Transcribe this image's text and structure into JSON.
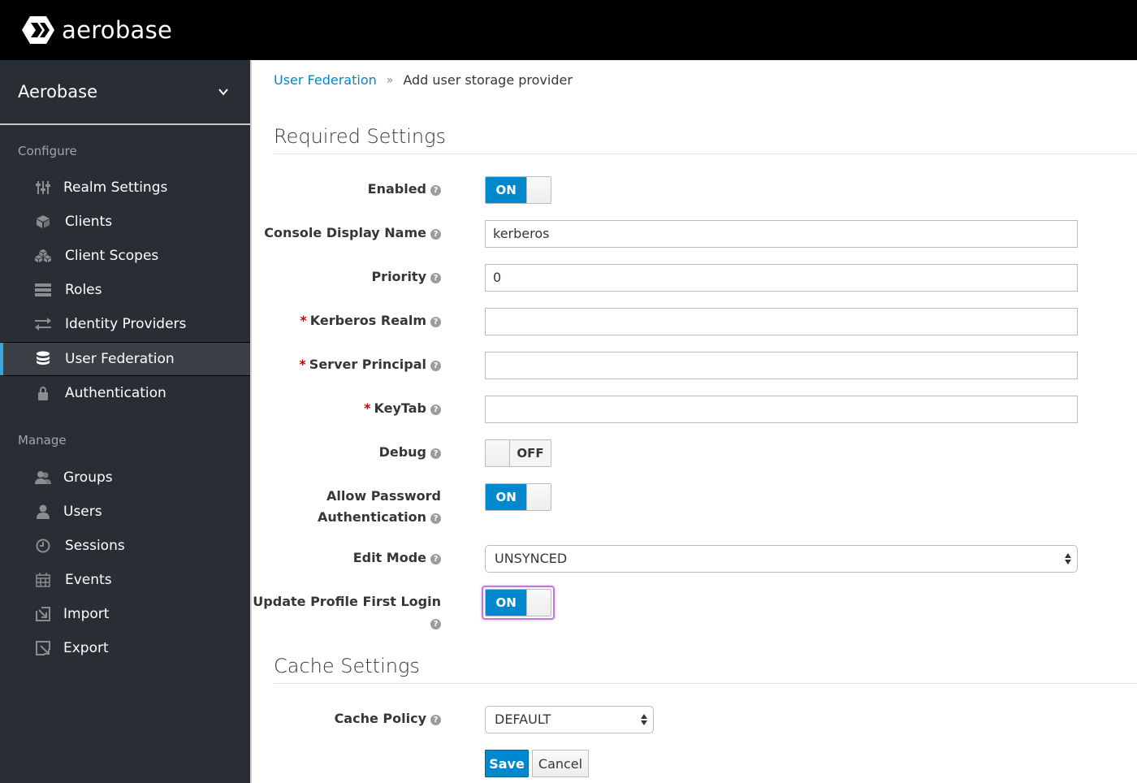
{
  "header": {
    "brand": "aerobase"
  },
  "sidebar": {
    "realm": "Aerobase",
    "configure_label": "Configure",
    "manage_label": "Manage",
    "configure_items": [
      {
        "label": "Realm Settings",
        "icon": "sliders-icon"
      },
      {
        "label": "Clients",
        "icon": "cube-icon"
      },
      {
        "label": "Client Scopes",
        "icon": "cubes-icon"
      },
      {
        "label": "Roles",
        "icon": "list-icon"
      },
      {
        "label": "Identity Providers",
        "icon": "exchange-icon"
      },
      {
        "label": "User Federation",
        "icon": "database-icon",
        "active": true
      },
      {
        "label": "Authentication",
        "icon": "lock-icon"
      }
    ],
    "manage_items": [
      {
        "label": "Groups",
        "icon": "users-icon"
      },
      {
        "label": "Users",
        "icon": "user-icon"
      },
      {
        "label": "Sessions",
        "icon": "clock-icon"
      },
      {
        "label": "Events",
        "icon": "calendar-icon"
      },
      {
        "label": "Import",
        "icon": "import-icon"
      },
      {
        "label": "Export",
        "icon": "export-icon"
      }
    ]
  },
  "breadcrumb": {
    "parent": "User Federation",
    "separator": "»",
    "current": "Add user storage provider"
  },
  "required_settings": {
    "title": "Required Settings",
    "enabled": {
      "label": "Enabled",
      "state": "ON"
    },
    "console_display_name": {
      "label": "Console Display Name",
      "value": "kerberos"
    },
    "priority": {
      "label": "Priority",
      "value": "0"
    },
    "kerberos_realm": {
      "label": "Kerberos Realm",
      "required_marker": "*",
      "value": ""
    },
    "server_principal": {
      "label": "Server Principal",
      "required_marker": "*",
      "value": ""
    },
    "keytab": {
      "label": "KeyTab",
      "required_marker": "*",
      "value": ""
    },
    "debug": {
      "label": "Debug",
      "state": "OFF"
    },
    "allow_password_auth": {
      "label_line1": "Allow Password",
      "label_line2": "Authentication",
      "state": "ON"
    },
    "edit_mode": {
      "label": "Edit Mode",
      "value": "UNSYNCED"
    },
    "update_profile_first_login": {
      "label": "Update Profile First Login",
      "state": "ON"
    }
  },
  "cache_settings": {
    "title": "Cache Settings",
    "cache_policy": {
      "label": "Cache Policy",
      "value": "DEFAULT"
    }
  },
  "actions": {
    "save": "Save",
    "cancel": "Cancel"
  },
  "help_glyph": "?",
  "colors": {
    "primary": "#0088ce",
    "sidebar_bg": "#292e34",
    "active_bar": "#39a5dc",
    "required": "#cc0000",
    "focus": "#c27ad6"
  }
}
